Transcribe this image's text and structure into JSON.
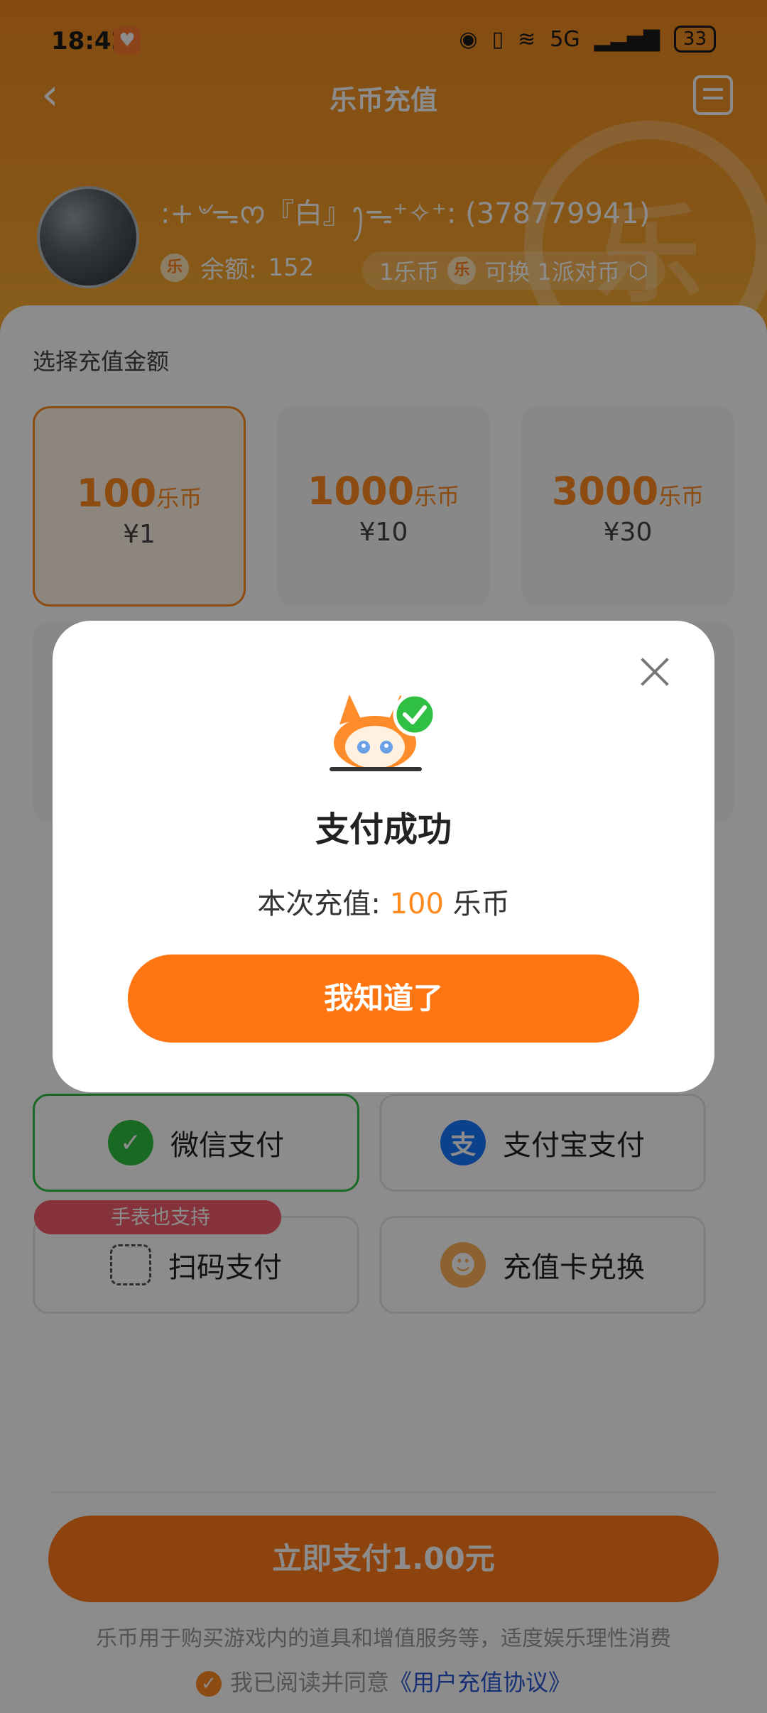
{
  "status_bar": {
    "time": "18:42",
    "network": "5G",
    "battery": "33"
  },
  "header": {
    "title": "乐币充值",
    "logo_char": "乐"
  },
  "user": {
    "name": ":+৺ᯓᰔ『白』ꫂᯓ⁺✧⁺: (378779941)",
    "balance_label": "余额:",
    "balance_value": "152",
    "coin_symbol": "乐"
  },
  "exchange": {
    "text1": "1乐币",
    "text2": "可换 1派对币"
  },
  "section_title": "选择充值金额",
  "packages": [
    {
      "amount": "100",
      "unit": "乐币",
      "price": "¥1"
    },
    {
      "amount": "1000",
      "unit": "乐币",
      "price": "¥10"
    },
    {
      "amount": "3000",
      "unit": "乐币",
      "price": "¥30"
    }
  ],
  "payment_methods": [
    {
      "label": "微信支付",
      "icon": "wechat-icon"
    },
    {
      "label": "支付宝支付",
      "icon": "alipay-icon",
      "icon_char": "支"
    },
    {
      "label": "扫码支付",
      "icon": "scan-icon"
    },
    {
      "label": "充值卡兑换",
      "icon": "mascot-icon"
    }
  ],
  "tag": "手表也支持",
  "cta": "立即支付1.00元",
  "notice": "乐币用于购买游戏内的道具和增值服务等，适度娱乐理性消费",
  "agreement": {
    "prefix": "我已阅读并同意",
    "link": "《用户充值协议》"
  },
  "modal": {
    "title": "支付成功",
    "sub_label": "本次充值:",
    "sub_value": "100",
    "sub_unit": "乐币",
    "button": "我知道了"
  },
  "colors": {
    "accent": "#ff7a1a",
    "wechat": "#2fbf42",
    "alipay": "#1677ff"
  }
}
